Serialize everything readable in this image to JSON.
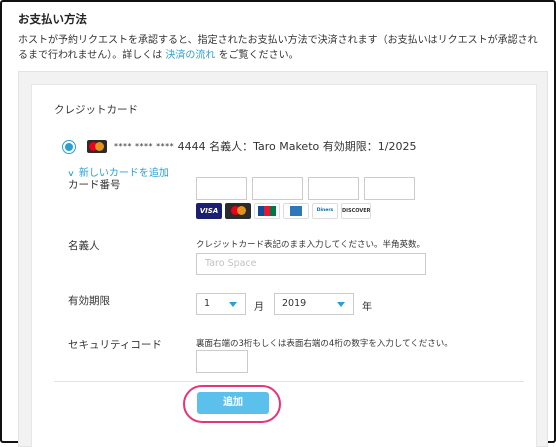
{
  "section": {
    "title": "お支払い方法",
    "desc_line1": "ホストが予約リクエストを承認すると、指定されたお支払い方法で決済されます（お支払いはリクエストが承認され",
    "desc_line2_pre": "るまで行われません）。詳しくは ",
    "desc_link": "決済の流れ",
    "desc_line2_post": " をご覧ください。"
  },
  "card": {
    "heading": "クレジットカード",
    "saved_mask": "**** **** ****",
    "saved_text": " 4444 名義人：Taro Maketo 有効期限：1/2025",
    "add_new": "新しいカードを追加"
  },
  "form": {
    "card_number_label": "カード番号",
    "brands": [
      "VISA",
      "MasterCard",
      "JCB",
      "AMEX",
      "Diners Club",
      "DISCOVER"
    ],
    "name_label": "名義人",
    "name_help": "クレジットカード表記のまま入力してください。半角英数。",
    "name_placeholder": "Taro Space",
    "expiry_label": "有効期限",
    "month_value": "1",
    "month_unit": "月",
    "year_value": "2019",
    "year_unit": "年",
    "security_label": "セキュリティコード",
    "security_help": "裏面右端の3桁もしくは表面右端の4桁の数字を入力してください。",
    "submit": "追加"
  },
  "colors": {
    "accent": "#2a9fd6",
    "button": "#5bc0eb",
    "highlight": "#e8337a"
  }
}
